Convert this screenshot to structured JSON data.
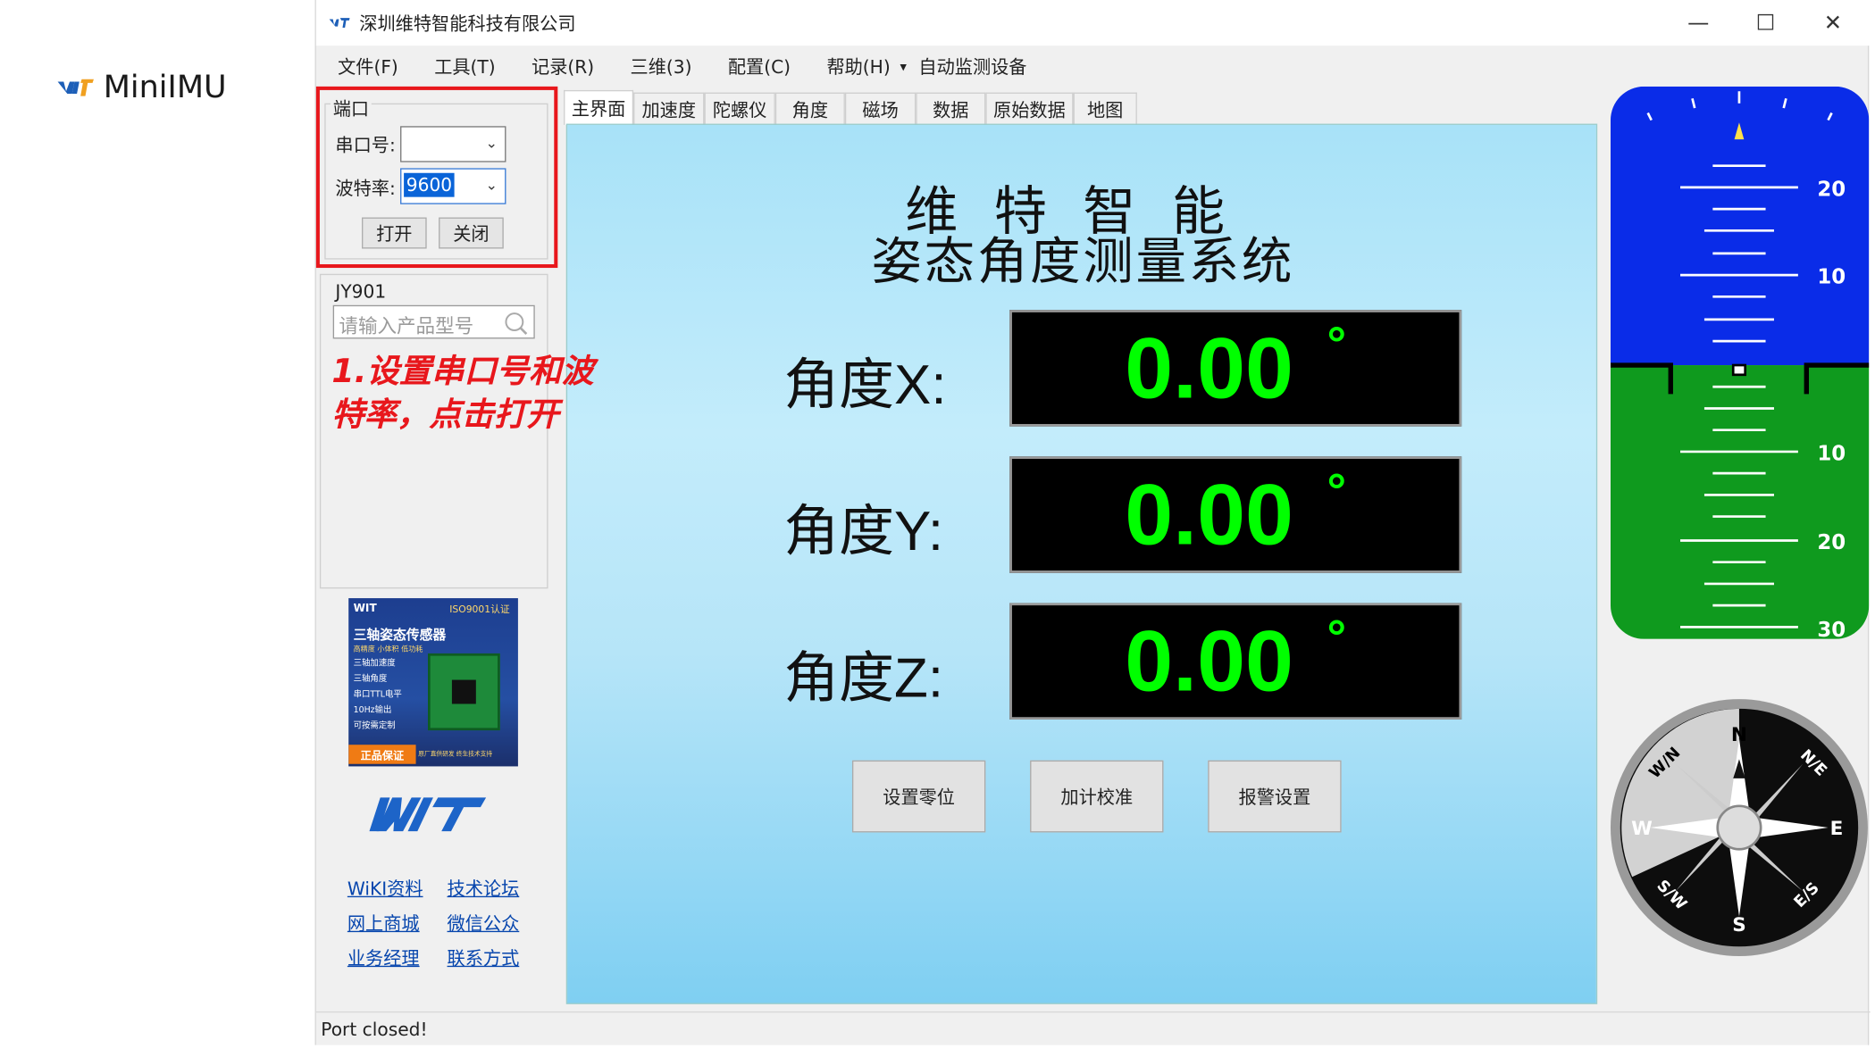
{
  "doc": {
    "logo_text": "MiniIMU"
  },
  "window": {
    "title": "深圳维特智能科技有限公司",
    "controls": {
      "minimize": "—",
      "maximize": "☐",
      "close": "✕"
    }
  },
  "menu": [
    "文件(F)",
    "工具(T)",
    "记录(R)",
    "三维(3)",
    "配置(C)",
    "帮助(H)",
    "▾",
    "自动监测设备"
  ],
  "port": {
    "group_label": "端口",
    "serial_label": "串口号:",
    "serial_value": "",
    "baud_label": "波特率:",
    "baud_value": "9600",
    "open_button": "打开",
    "close_button": "关闭"
  },
  "product": {
    "group_label": "JY901",
    "search_placeholder": "请输入产品型号"
  },
  "annotation": "1.设置串口号和波\n特率，点击打开",
  "promo": {
    "title": "三轴姿态传感器",
    "badge": "ISO9001认证",
    "lines": [
      "三轴加速度",
      "三轴角度",
      "串口TTL电平",
      "10Hz输出",
      "可按需定制"
    ],
    "guarantee": "正品保证",
    "footer": "原厂直供研发 终生技术支持",
    "sub": "高精度 小体积 低功耗"
  },
  "brand": "WIT",
  "links": [
    "WiKI资料",
    "技术论坛",
    "网上商城",
    "微信公众",
    "业务经理",
    "联系方式"
  ],
  "tabs": [
    "主界面",
    "加速度",
    "陀螺仪",
    "角度",
    "磁场",
    "数据",
    "原始数据",
    "地图"
  ],
  "main": {
    "title1": "维特智能",
    "title2": "姿态角度测量系统",
    "angles": [
      {
        "label": "角度X:",
        "value": "0.00",
        "unit": "°"
      },
      {
        "label": "角度Y:",
        "value": "0.00",
        "unit": "°"
      },
      {
        "label": "角度Z:",
        "value": "0.00",
        "unit": "°"
      }
    ],
    "buttons": [
      "设置零位",
      "加计校准",
      "报警设置"
    ]
  },
  "attitude": {
    "labels": [
      "20",
      "10",
      "10",
      "20",
      "30"
    ],
    "sky_color": "#0a2ce8",
    "ground_color": "#0f9a1e"
  },
  "compass": {
    "labels": [
      "N",
      "N/E",
      "E",
      "E/S",
      "S",
      "S/W",
      "W",
      "W/N"
    ]
  },
  "status": "Port closed!"
}
